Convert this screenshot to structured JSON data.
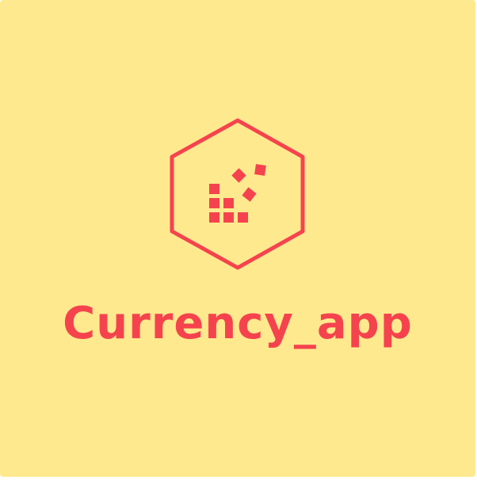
{
  "logo": {
    "app_name": "Currency_app",
    "icon": "hexagon-pixel-blocks-icon"
  },
  "colors": {
    "background": "#FFE98E",
    "accent": "#F5434E"
  }
}
